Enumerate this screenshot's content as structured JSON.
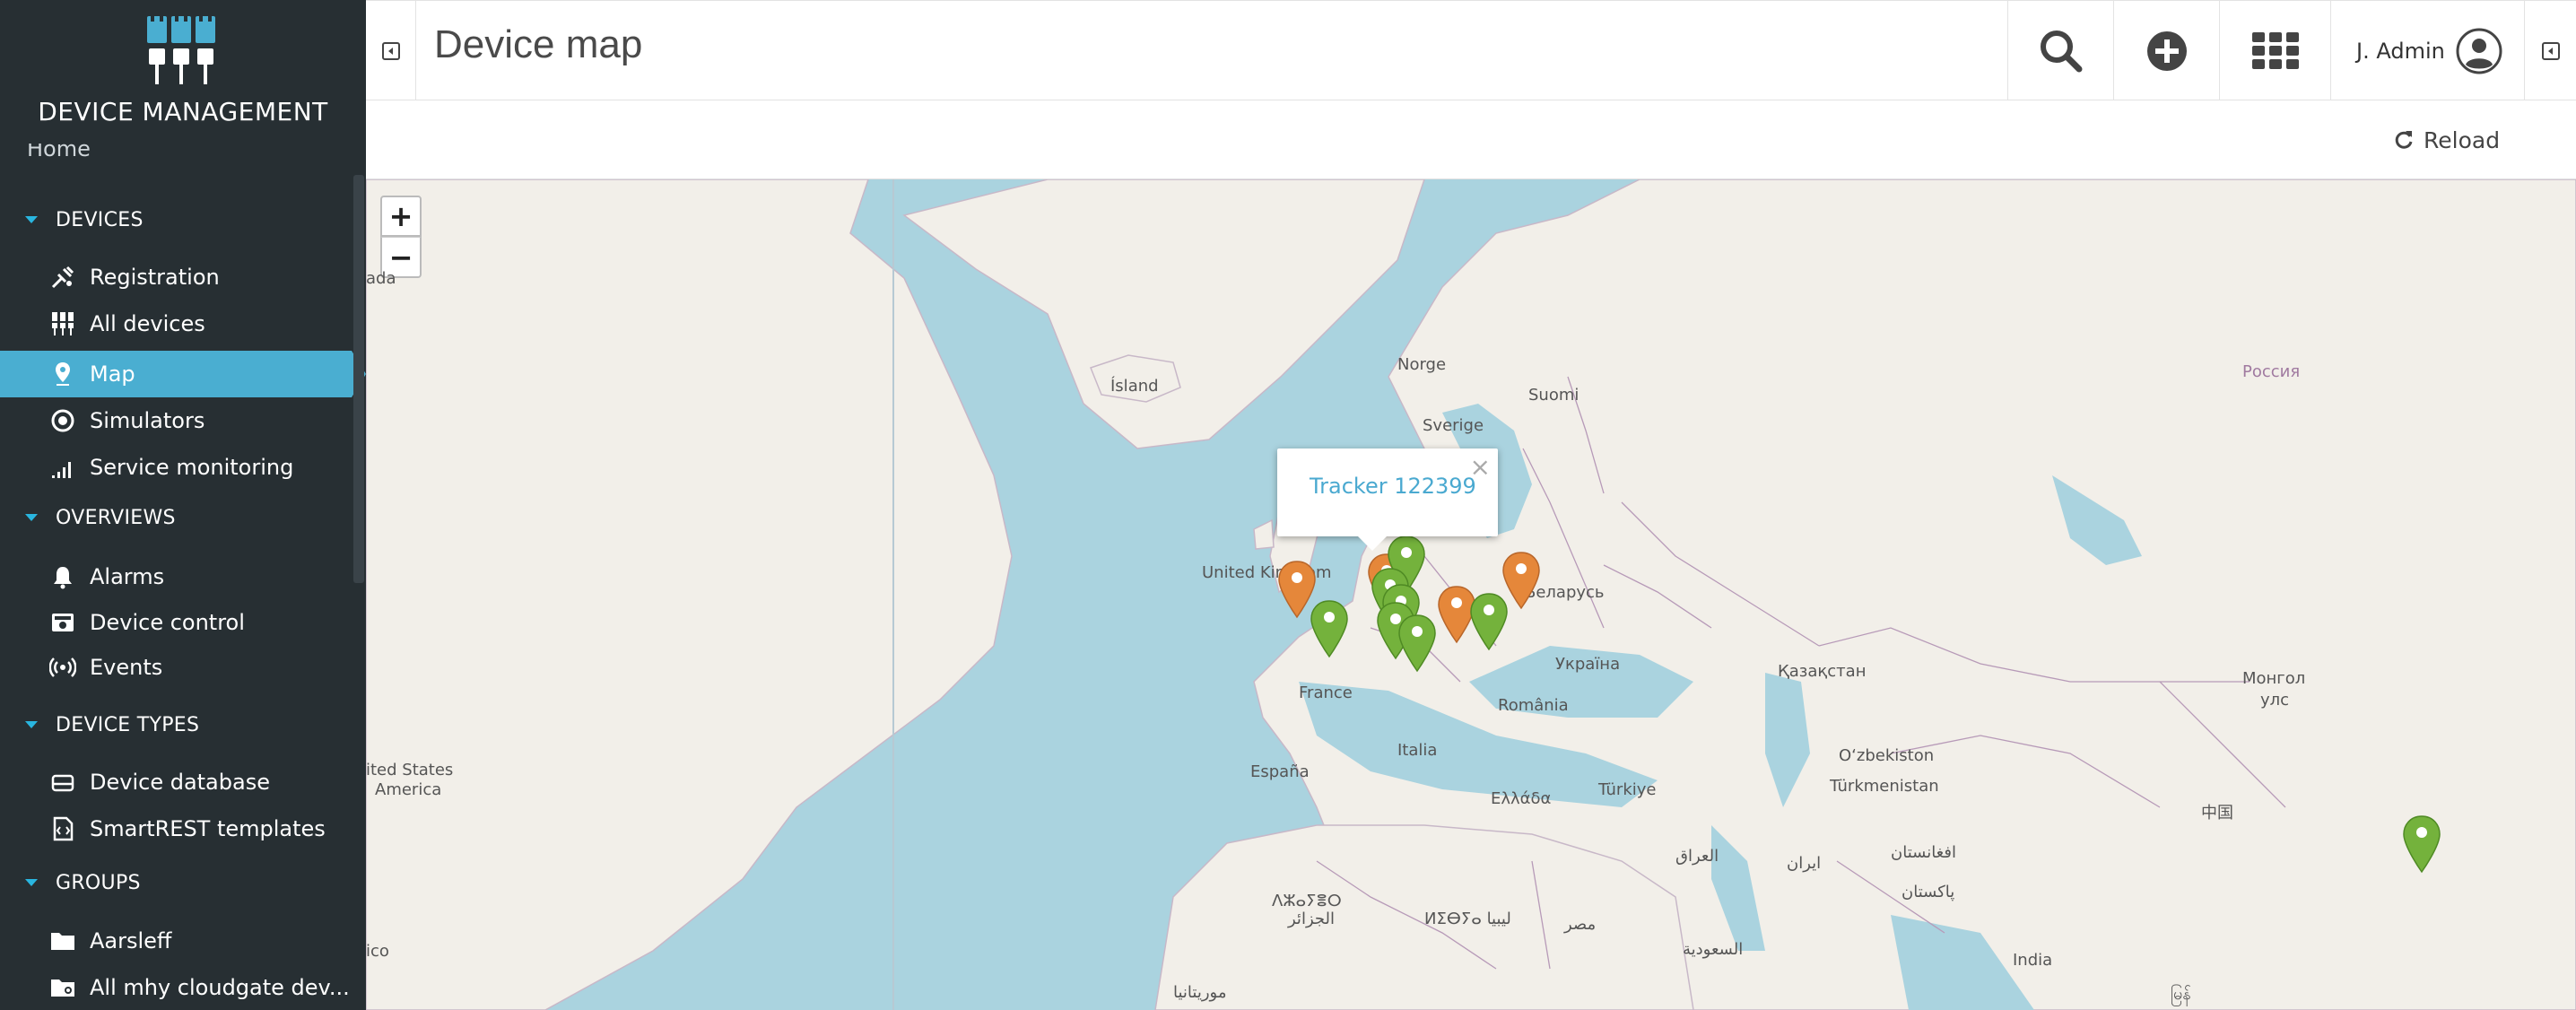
{
  "brand": {
    "title": "DEVICE MANAGEMENT"
  },
  "sidebar": {
    "home_label": "Home",
    "sections": [
      {
        "label": "DEVICES",
        "items": [
          {
            "label": "Registration",
            "icon": "registration-icon"
          },
          {
            "label": "All devices",
            "icon": "devices-icon"
          },
          {
            "label": "Map",
            "icon": "map-pin-icon",
            "active": true
          },
          {
            "label": "Simulators",
            "icon": "simulator-icon"
          },
          {
            "label": "Service monitoring",
            "icon": "signal-bars-icon"
          }
        ]
      },
      {
        "label": "OVERVIEWS",
        "items": [
          {
            "label": "Alarms",
            "icon": "bell-icon"
          },
          {
            "label": "Device control",
            "icon": "device-control-icon"
          },
          {
            "label": "Events",
            "icon": "broadcast-icon"
          }
        ]
      },
      {
        "label": "DEVICE TYPES",
        "items": [
          {
            "label": "Device database",
            "icon": "database-icon"
          },
          {
            "label": "SmartREST templates",
            "icon": "code-file-icon"
          }
        ]
      },
      {
        "label": "GROUPS",
        "items": [
          {
            "label": "Aarsleff",
            "icon": "folder-icon"
          },
          {
            "label": "All mhy cloudgate dev...",
            "icon": "folder-gear-icon"
          }
        ]
      }
    ]
  },
  "header": {
    "title": "Device map",
    "user": "J. Admin"
  },
  "actions": {
    "reload": "Reload"
  },
  "map": {
    "zoom_in": "+",
    "zoom_out": "−",
    "popup_title": "Tracker 122399",
    "popup_close": "×",
    "labels": {
      "island": "Ísland",
      "norge": "Norge",
      "suomi": "Suomi",
      "sverige": "Sverige",
      "uk": "United Kingdom",
      "belarus": "Беларусь",
      "rossiya": "Россия",
      "ukraina": "Україна",
      "kazakhstan": "Қазақстан",
      "mongol": "Монгол",
      "mongol2": "улс",
      "france": "France",
      "romania": "România",
      "espana": "España",
      "italia": "Italia",
      "ellada": "Ελλάδα",
      "turkiye": "Türkiye",
      "uzbekiston": "O‘zbekiston",
      "turkmenistan": "Türkmenistan",
      "us": "ited States",
      "us2": "America",
      "iraq": "العراق",
      "iran": "ایران",
      "afghanistan": "افغانستان",
      "pakistan": "پاکستان",
      "india": "India",
      "china": "中国",
      "masr": "مصر",
      "saudi": "السعودية",
      "libya": "ⵍⵉⴱⵢⴰ ليبيا",
      "algeria": "ⴷⵣⴰⵢⴻⵔ",
      "algeria2": "الجزائر",
      "mauritania": "موريتانيا",
      "ada": "ada",
      "ico": "ico",
      "myanmar": "မြန်"
    },
    "markers": [
      {
        "name": "marker-orange",
        "color": "#e5873a"
      },
      {
        "name": "marker-green",
        "color": "#74b23c"
      }
    ]
  }
}
